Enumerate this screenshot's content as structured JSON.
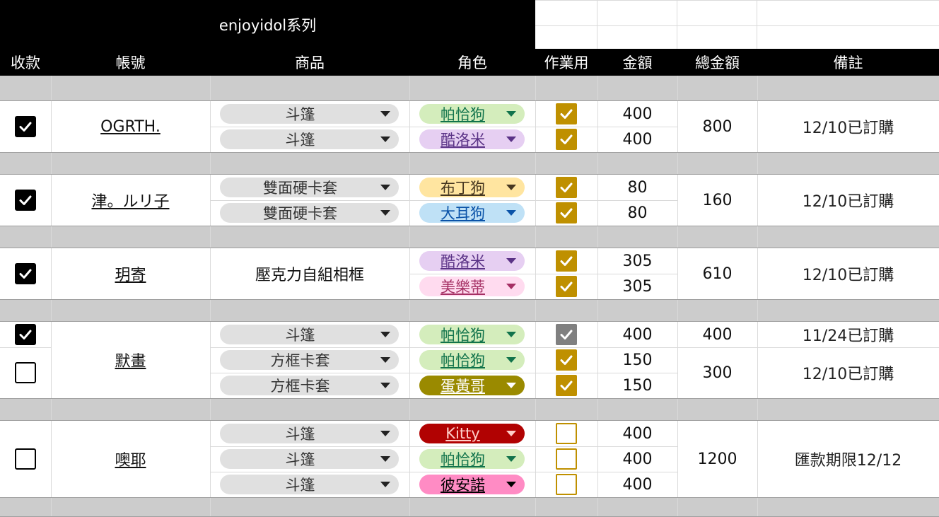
{
  "sheet": {
    "title": "enjoyidol系列",
    "headers": [
      "收款",
      "帳號",
      "商品",
      "角色",
      "作業用",
      "金額",
      "總金額",
      "備註"
    ]
  },
  "rows": [
    {
      "paid": true,
      "account": "OGRTH.",
      "product": "斗篷",
      "role": "帕恰狗",
      "work": true,
      "amount": "400"
    },
    {
      "paid": null,
      "account": null,
      "product": "斗篷",
      "role": "酷洛米",
      "work": true,
      "amount": "400"
    },
    {
      "paid": true,
      "account": "津。ルリ子",
      "product": "雙面硬卡套",
      "role": "布丁狗",
      "work": true,
      "amount": "80"
    },
    {
      "paid": null,
      "account": null,
      "product": "雙面硬卡套",
      "role": "大耳狗",
      "work": true,
      "amount": "80"
    },
    {
      "paid": true,
      "account": "玥寄",
      "product": "壓克力自組相框",
      "role": "酷洛米",
      "work": true,
      "amount": "305"
    },
    {
      "paid": null,
      "account": null,
      "product": null,
      "role": "美樂蒂",
      "work": true,
      "amount": "305"
    },
    {
      "paid": true,
      "account": "默畫",
      "product": "斗篷",
      "role": "帕恰狗",
      "work": "grey",
      "amount": "400"
    },
    {
      "paid": false,
      "account": null,
      "product": "方框卡套",
      "role": "帕恰狗",
      "work": true,
      "amount": "150"
    },
    {
      "paid": null,
      "account": null,
      "product": "方框卡套",
      "role": "蛋黃哥",
      "work": true,
      "amount": "150"
    },
    {
      "paid": false,
      "account": "噢耶",
      "product": "斗篷",
      "role": "Kitty",
      "work": false,
      "amount": "400"
    },
    {
      "paid": null,
      "account": null,
      "product": "斗篷",
      "role": "帕恰狗",
      "work": false,
      "amount": "400"
    },
    {
      "paid": null,
      "account": null,
      "product": "斗篷",
      "role": "彼安諾",
      "work": false,
      "amount": "400"
    }
  ],
  "totals": [
    "800",
    "160",
    "610",
    "400",
    "300",
    "1200"
  ],
  "notes": [
    "12/10已訂購",
    "12/10已訂購",
    "12/10已訂購",
    "11/24已訂購",
    "12/10已訂購",
    "匯款期限12/12"
  ],
  "role_colors": {
    "帕恰狗": {
      "bg": "#d4edbc",
      "fg": "#11734b"
    },
    "酷洛米": {
      "bg": "#e6cff2",
      "fg": "#5a3286"
    },
    "布丁狗": {
      "bg": "#ffe5a0",
      "fg": "#473821"
    },
    "大耳狗": {
      "bg": "#bfe1f6",
      "fg": "#0a53a8"
    },
    "美樂蒂": {
      "bg": "#ffdbef",
      "fg": "#a53064"
    },
    "蛋黃哥": {
      "bg": "#9a8a00",
      "fg": "#ffffff"
    },
    "Kitty": {
      "bg": "#b10202",
      "fg": "#ffcfc9"
    },
    "彼安諾": {
      "bg": "#ff8bc4",
      "fg": "#000000"
    }
  },
  "colors": {
    "accent_checkbox": "#bf9000",
    "header_bg": "#000000",
    "separator_bg": "#cccccc"
  }
}
